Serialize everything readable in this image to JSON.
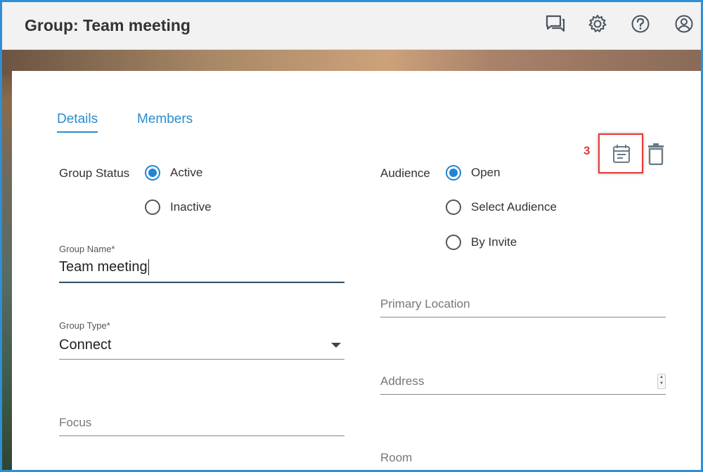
{
  "header": {
    "title": "Group: Team meeting",
    "icons": [
      "chat-icon",
      "settings-icon",
      "help-icon",
      "account-icon"
    ]
  },
  "tabs": [
    {
      "label": "Details",
      "active": true
    },
    {
      "label": "Members",
      "active": false
    }
  ],
  "group_status": {
    "label": "Group Status",
    "options": [
      {
        "label": "Active",
        "selected": true
      },
      {
        "label": "Inactive",
        "selected": false
      }
    ]
  },
  "audience": {
    "label": "Audience",
    "options": [
      {
        "label": "Open",
        "selected": true
      },
      {
        "label": "Select Audience",
        "selected": false
      },
      {
        "label": "By Invite",
        "selected": false
      }
    ]
  },
  "group_name": {
    "label": "Group Name*",
    "value": "Team meeting"
  },
  "group_type": {
    "label": "Group Type*",
    "value": "Connect"
  },
  "focus": {
    "placeholder": "Focus"
  },
  "primary_location": {
    "placeholder": "Primary Location"
  },
  "address": {
    "placeholder": "Address"
  },
  "room": {
    "placeholder": "Room"
  },
  "callout": {
    "number": "3"
  },
  "actions": [
    "calendar-icon",
    "delete-icon"
  ],
  "colors": {
    "accent": "#2b8ccc",
    "border": "#2f8fd4",
    "highlight": "#e53935"
  }
}
